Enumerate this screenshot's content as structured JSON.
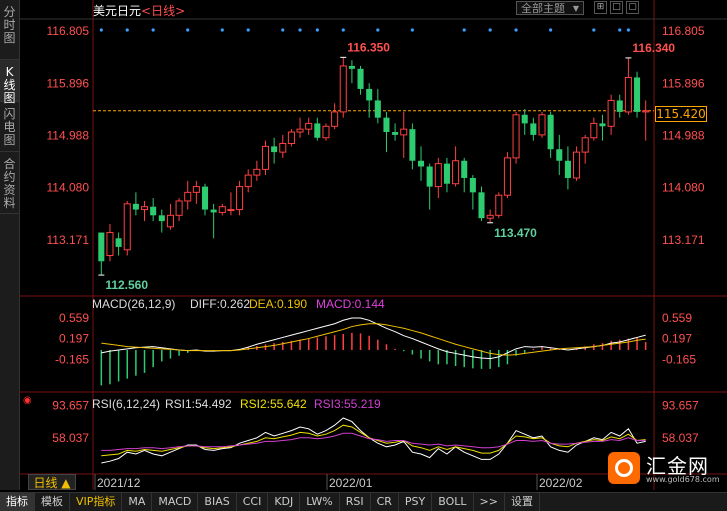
{
  "sidebar": {
    "tabs": [
      {
        "label": "分时图",
        "name": "tab-timeshare",
        "active": false
      },
      {
        "label": "K线图",
        "name": "tab-kline",
        "active": true
      },
      {
        "label": "闪电图",
        "name": "tab-flash",
        "active": false
      },
      {
        "label": "合约资料",
        "name": "tab-contract",
        "active": false
      }
    ]
  },
  "header": {
    "title": "美元日元",
    "period_tag": "<日线>",
    "theme_select": "全部主题",
    "window_buttons": [
      "⊞",
      "□",
      "▢"
    ]
  },
  "main_chart": {
    "y_ticks": [
      "116.805",
      "115.896",
      "114.988",
      "114.080",
      "113.171"
    ],
    "current_price": "115.420",
    "high_label_1": "116.350",
    "high_label_2": "116.340",
    "low_label_1": "112.560",
    "low_label_2": "113.470"
  },
  "macd": {
    "title": "MACD(26,12,9)",
    "diff": "DIFF:0.262",
    "dea": "DEA:0.190",
    "macd": "MACD:0.144",
    "y_ticks": [
      "0.559",
      "0.197",
      "-0.165"
    ]
  },
  "rsi": {
    "title": "RSI(6,12,24)",
    "rsi1": "RSI1:54.492",
    "rsi2": "RSI2:55.642",
    "rsi3": "RSI3:55.219",
    "y_ticks": [
      "93.657",
      "58.037"
    ]
  },
  "x_axis": {
    "labels": [
      "2021/12",
      "2022/01",
      "2022/02"
    ]
  },
  "period_button": "日线 ▲",
  "bottom_tabs": [
    "指标",
    "模板",
    "VIP指标",
    "MA",
    "MACD",
    "BIAS",
    "CCI",
    "KDJ",
    "LW%",
    "RSI",
    "CR",
    "PSY",
    "BOLL",
    ">>",
    "设置"
  ],
  "logo": {
    "name": "汇金网",
    "url": "www.gold678.com"
  },
  "colors": {
    "up": "#ff4040",
    "down": "#2ecc71",
    "grid": "#7a1010",
    "diff_line": "#ffffff",
    "dea_line": "#f0c000",
    "macd_label": "#e040e0",
    "price_line": "#ffa500"
  },
  "chart_data": {
    "type": "candlestick",
    "ylim": [
      112.3,
      117.0
    ],
    "candles": [
      [
        113.3,
        112.8,
        113.3,
        112.56
      ],
      [
        112.9,
        113.3,
        113.45,
        112.8
      ],
      [
        113.2,
        113.05,
        113.3,
        112.9
      ],
      [
        113.0,
        113.8,
        113.85,
        112.9
      ],
      [
        113.8,
        113.7,
        114.0,
        113.6
      ],
      [
        113.7,
        113.75,
        113.85,
        113.5
      ],
      [
        113.75,
        113.6,
        113.9,
        113.5
      ],
      [
        113.6,
        113.5,
        113.7,
        113.3
      ],
      [
        113.4,
        113.6,
        113.8,
        113.35
      ],
      [
        113.6,
        113.85,
        113.9,
        113.5
      ],
      [
        113.85,
        114.0,
        114.2,
        113.7
      ],
      [
        114.0,
        114.1,
        114.2,
        113.8
      ],
      [
        114.1,
        113.7,
        114.15,
        113.6
      ],
      [
        113.7,
        113.65,
        113.8,
        113.2
      ],
      [
        113.65,
        113.75,
        113.8,
        113.6
      ],
      [
        113.7,
        113.7,
        114.0,
        113.6
      ],
      [
        113.7,
        114.1,
        114.2,
        113.6
      ],
      [
        114.1,
        114.3,
        114.4,
        114.0
      ],
      [
        114.3,
        114.4,
        114.55,
        114.2
      ],
      [
        114.4,
        114.8,
        114.9,
        114.3
      ],
      [
        114.8,
        114.7,
        114.95,
        114.5
      ],
      [
        114.7,
        114.85,
        115.0,
        114.6
      ],
      [
        114.85,
        115.05,
        115.1,
        114.8
      ],
      [
        115.05,
        115.1,
        115.3,
        114.95
      ],
      [
        115.1,
        115.2,
        115.3,
        115.0
      ],
      [
        115.2,
        114.95,
        115.3,
        114.9
      ],
      [
        114.95,
        115.15,
        115.2,
        114.9
      ],
      [
        115.15,
        115.4,
        115.55,
        115.1
      ],
      [
        115.4,
        116.2,
        116.35,
        115.3
      ],
      [
        116.2,
        116.15,
        116.3,
        115.9
      ],
      [
        116.15,
        115.8,
        116.2,
        115.7
      ],
      [
        115.8,
        115.6,
        115.9,
        115.3
      ],
      [
        115.6,
        115.3,
        115.8,
        115.2
      ],
      [
        115.3,
        115.05,
        115.4,
        114.7
      ],
      [
        115.05,
        115.0,
        115.2,
        114.9
      ],
      [
        115.0,
        115.1,
        115.4,
        114.6
      ],
      [
        115.1,
        114.55,
        115.2,
        114.4
      ],
      [
        114.55,
        114.45,
        114.8,
        114.2
      ],
      [
        114.45,
        114.1,
        114.5,
        113.7
      ],
      [
        114.1,
        114.5,
        114.6,
        113.9
      ],
      [
        114.5,
        114.15,
        114.6,
        114.0
      ],
      [
        114.15,
        114.55,
        114.8,
        114.1
      ],
      [
        114.55,
        114.25,
        114.6,
        114.0
      ],
      [
        114.25,
        114.0,
        114.3,
        113.7
      ],
      [
        114.0,
        113.55,
        114.1,
        113.5
      ],
      [
        113.55,
        113.6,
        113.7,
        113.47
      ],
      [
        113.6,
        113.95,
        114.0,
        113.55
      ],
      [
        113.95,
        114.6,
        114.7,
        113.9
      ],
      [
        114.6,
        115.35,
        115.4,
        114.5
      ],
      [
        115.35,
        115.2,
        115.45,
        115.0
      ],
      [
        115.2,
        115.0,
        115.3,
        114.9
      ],
      [
        115.0,
        115.35,
        115.4,
        114.95
      ],
      [
        115.35,
        114.75,
        115.4,
        114.6
      ],
      [
        114.75,
        114.55,
        115.0,
        114.3
      ],
      [
        114.55,
        114.25,
        114.8,
        114.05
      ],
      [
        114.25,
        114.7,
        114.8,
        114.2
      ],
      [
        114.7,
        114.95,
        115.0,
        114.5
      ],
      [
        114.95,
        115.2,
        115.3,
        114.9
      ],
      [
        115.2,
        115.15,
        115.35,
        114.9
      ],
      [
        115.15,
        115.6,
        115.7,
        115.0
      ],
      [
        115.6,
        115.4,
        115.7,
        115.3
      ],
      [
        115.4,
        116.0,
        116.34,
        115.35
      ],
      [
        116.0,
        115.4,
        116.1,
        115.3
      ],
      [
        115.4,
        115.42,
        115.6,
        114.9
      ]
    ],
    "macd_hist": [
      -0.62,
      -0.6,
      -0.55,
      -0.5,
      -0.45,
      -0.4,
      -0.3,
      -0.2,
      -0.15,
      -0.1,
      -0.05,
      0.0,
      -0.02,
      -0.02,
      0.0,
      0.0,
      0.02,
      0.05,
      0.07,
      0.1,
      0.12,
      0.14,
      0.16,
      0.18,
      0.2,
      0.22,
      0.24,
      0.26,
      0.28,
      0.3,
      0.29,
      0.25,
      0.18,
      0.1,
      0.02,
      -0.02,
      -0.08,
      -0.15,
      -0.2,
      -0.25,
      -0.25,
      -0.28,
      -0.3,
      -0.32,
      -0.33,
      -0.33,
      -0.3,
      -0.25,
      -0.1,
      -0.05,
      0.02,
      0.05,
      0.04,
      0.02,
      0.0,
      0.03,
      0.06,
      0.1,
      0.12,
      0.16,
      0.18,
      0.2,
      0.22,
      0.14
    ],
    "diff_line": [
      -0.05,
      -0.02,
      0.0,
      0.02,
      0.04,
      0.05,
      0.06,
      0.04,
      0.02,
      0.0,
      -0.01,
      0.0,
      -0.02,
      -0.02,
      -0.01,
      -0.01,
      0.01,
      0.05,
      0.1,
      0.14,
      0.18,
      0.22,
      0.26,
      0.3,
      0.34,
      0.38,
      0.42,
      0.46,
      0.52,
      0.56,
      0.56,
      0.52,
      0.45,
      0.38,
      0.32,
      0.25,
      0.2,
      0.14,
      0.08,
      0.02,
      -0.03,
      -0.06,
      -0.09,
      -0.12,
      -0.14,
      -0.15,
      -0.12,
      -0.05,
      0.02,
      0.06,
      0.05,
      0.06,
      0.04,
      0.02,
      0.0,
      0.02,
      0.04,
      0.06,
      0.08,
      0.12,
      0.14,
      0.18,
      0.22,
      0.26
    ],
    "dea_line": [
      0.12,
      0.1,
      0.08,
      0.06,
      0.05,
      0.04,
      0.03,
      0.02,
      0.01,
      0.0,
      -0.01,
      -0.01,
      -0.01,
      -0.01,
      -0.01,
      -0.01,
      0.0,
      0.02,
      0.04,
      0.06,
      0.08,
      0.11,
      0.14,
      0.17,
      0.2,
      0.24,
      0.28,
      0.32,
      0.36,
      0.41,
      0.44,
      0.46,
      0.46,
      0.44,
      0.41,
      0.38,
      0.34,
      0.3,
      0.25,
      0.2,
      0.15,
      0.1,
      0.06,
      0.02,
      -0.02,
      -0.06,
      -0.08,
      -0.09,
      -0.08,
      -0.06,
      -0.04,
      -0.02,
      0.0,
      0.02,
      0.03,
      0.04,
      0.05,
      0.06,
      0.08,
      0.1,
      0.12,
      0.14,
      0.17,
      0.19
    ],
    "rsi1": [
      30,
      32,
      35,
      42,
      40,
      44,
      40,
      38,
      42,
      46,
      50,
      50,
      45,
      44,
      46,
      47,
      52,
      55,
      58,
      64,
      60,
      63,
      66,
      70,
      68,
      62,
      66,
      72,
      80,
      76,
      66,
      58,
      52,
      48,
      50,
      54,
      42,
      40,
      36,
      46,
      40,
      48,
      42,
      38,
      34,
      34,
      40,
      52,
      66,
      62,
      58,
      60,
      48,
      44,
      42,
      50,
      54,
      58,
      56,
      64,
      60,
      68,
      52,
      54
    ],
    "rsi2": [
      38,
      39,
      40,
      44,
      43,
      45,
      44,
      43,
      45,
      47,
      49,
      49,
      47,
      46,
      47,
      48,
      50,
      52,
      54,
      58,
      57,
      59,
      61,
      64,
      63,
      60,
      62,
      66,
      72,
      70,
      64,
      58,
      55,
      52,
      53,
      55,
      49,
      47,
      44,
      48,
      45,
      48,
      46,
      44,
      41,
      41,
      44,
      52,
      60,
      59,
      57,
      58,
      52,
      49,
      48,
      52,
      54,
      56,
      55,
      59,
      57,
      62,
      55,
      56
    ],
    "rsi3": [
      44,
      44,
      45,
      46,
      46,
      47,
      47,
      46,
      47,
      48,
      49,
      49,
      48,
      48,
      48,
      49,
      50,
      51,
      52,
      54,
      54,
      55,
      56,
      58,
      58,
      57,
      58,
      60,
      63,
      63,
      60,
      57,
      56,
      54,
      55,
      55,
      52,
      51,
      50,
      51,
      49,
      50,
      49,
      48,
      47,
      47,
      48,
      51,
      55,
      55,
      54,
      55,
      52,
      51,
      51,
      52,
      53,
      54,
      54,
      56,
      55,
      58,
      55,
      55
    ],
    "xlabel": "",
    "ylabel": ""
  }
}
